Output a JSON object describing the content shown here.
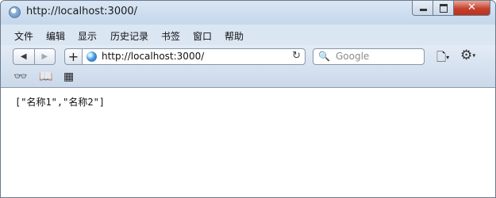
{
  "window": {
    "title": "http://localhost:3000/",
    "caption": {
      "minimize": "",
      "maximize": "",
      "close": "✕"
    }
  },
  "menu": [
    "文件",
    "编辑",
    "显示",
    "历史记录",
    "书签",
    "窗口",
    "帮助"
  ],
  "toolbar": {
    "back": "◀",
    "forward": "▶",
    "add": "+",
    "url": "http://localhost:3000/",
    "reload": "↻",
    "search_placeholder": "Google",
    "search_icon": "🔍",
    "page_menu": "🗋",
    "settings": "⚙",
    "caret": "▾"
  },
  "bookmarks_bar": {
    "reading_list": "👓",
    "bookmarks": "📖",
    "top_sites": "▦"
  },
  "content": {
    "body_text": "[\"名称1\",\"名称2\"]"
  }
}
